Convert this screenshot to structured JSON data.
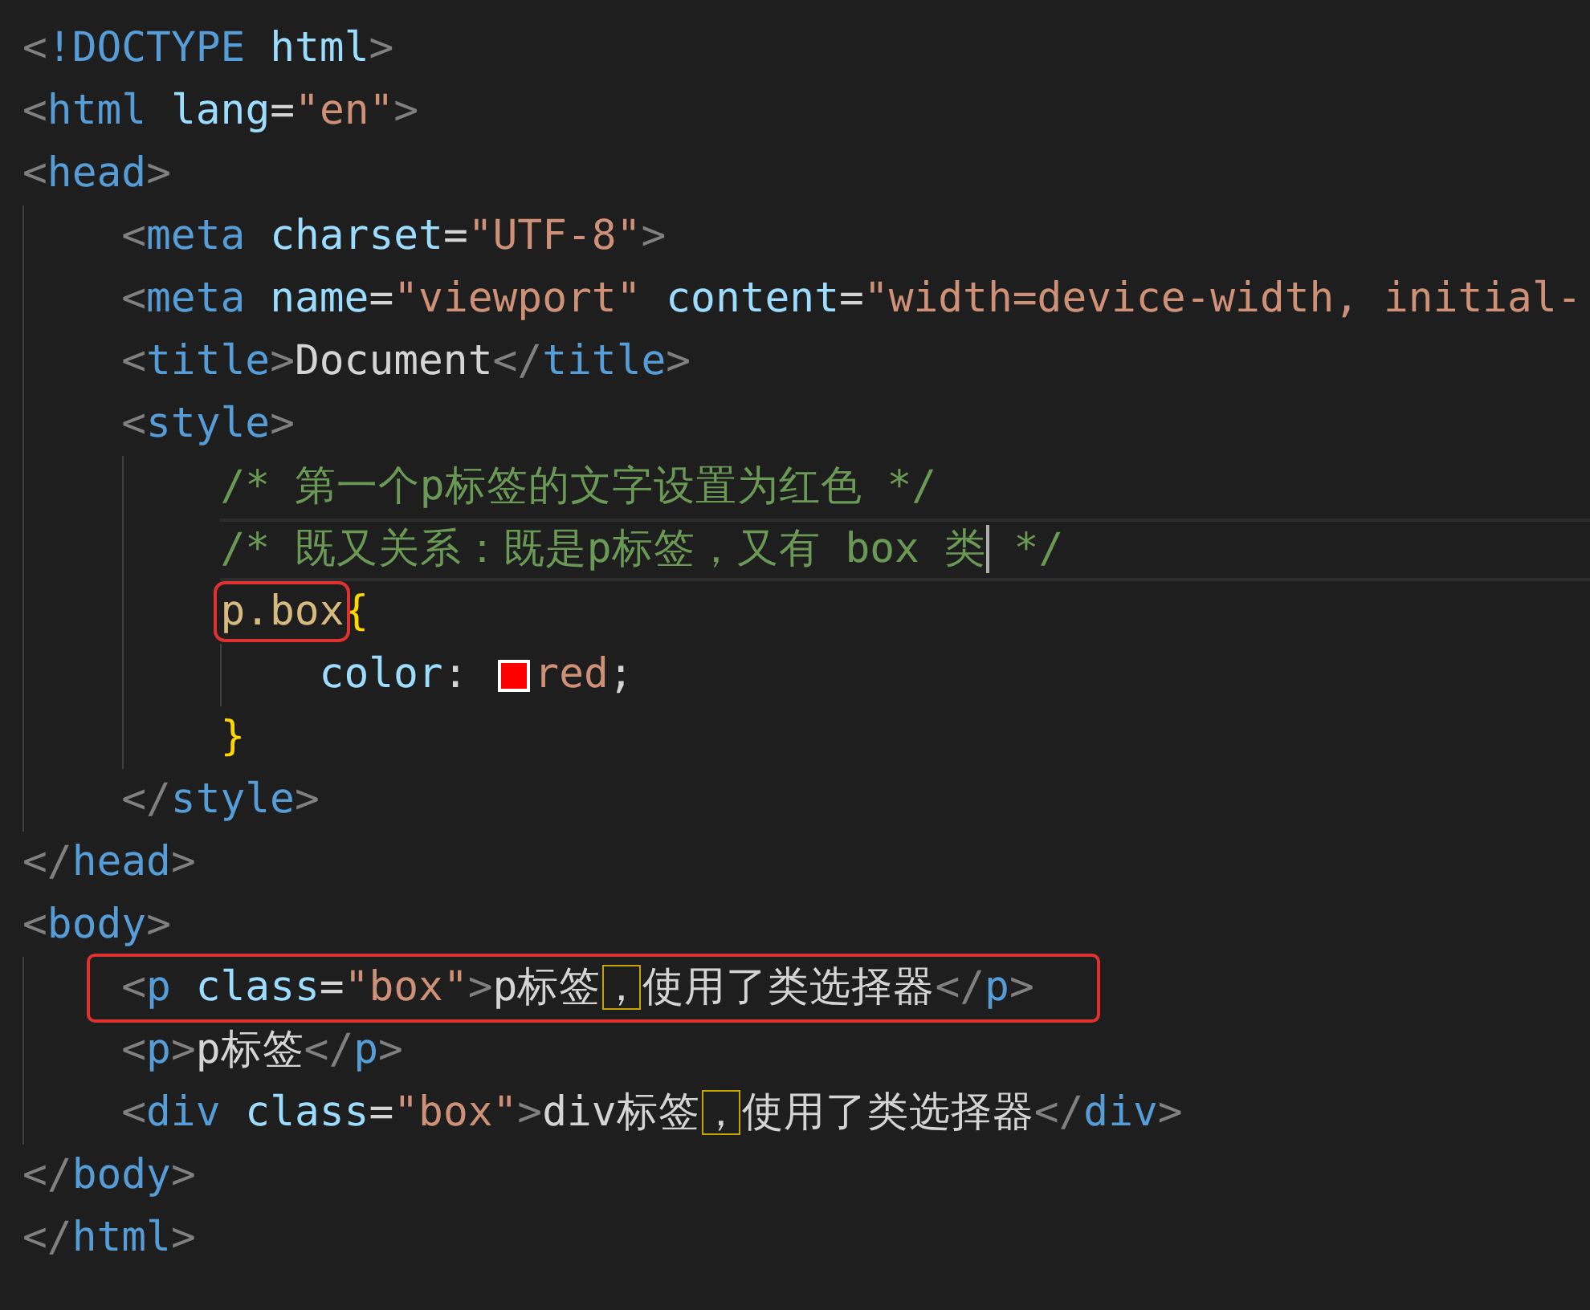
{
  "lines": [
    {
      "tokens": [
        {
          "kind": "punct",
          "text": "<"
        },
        {
          "kind": "tag",
          "text": "!DOCTYPE "
        },
        {
          "kind": "attr",
          "text": "html"
        },
        {
          "kind": "punct",
          "text": ">"
        }
      ]
    },
    {
      "tokens": [
        {
          "kind": "punct",
          "text": "<"
        },
        {
          "kind": "tag",
          "text": "html "
        },
        {
          "kind": "attr",
          "text": "lang"
        },
        {
          "kind": "text",
          "text": "="
        },
        {
          "kind": "string",
          "text": "\"en\""
        },
        {
          "kind": "punct",
          "text": ">"
        }
      ]
    },
    {
      "tokens": [
        {
          "kind": "punct",
          "text": "<"
        },
        {
          "kind": "tag",
          "text": "head"
        },
        {
          "kind": "punct",
          "text": ">"
        }
      ],
      "children": [
        {
          "tokens": [
            {
              "kind": "punct",
              "text": "<"
            },
            {
              "kind": "tag",
              "text": "meta "
            },
            {
              "kind": "attr",
              "text": "charset"
            },
            {
              "kind": "text",
              "text": "="
            },
            {
              "kind": "string",
              "text": "\"UTF-8\""
            },
            {
              "kind": "punct",
              "text": ">"
            }
          ]
        },
        {
          "tokens": [
            {
              "kind": "punct",
              "text": "<"
            },
            {
              "kind": "tag",
              "text": "meta "
            },
            {
              "kind": "attr",
              "text": "name"
            },
            {
              "kind": "text",
              "text": "="
            },
            {
              "kind": "string",
              "text": "\"viewport\" "
            },
            {
              "kind": "attr",
              "text": "content"
            },
            {
              "kind": "text",
              "text": "="
            },
            {
              "kind": "string",
              "text": "\"width=device-width, initial-"
            }
          ]
        },
        {
          "tokens": [
            {
              "kind": "punct",
              "text": "<"
            },
            {
              "kind": "tag",
              "text": "title"
            },
            {
              "kind": "punct",
              "text": ">"
            },
            {
              "kind": "text",
              "text": "Document"
            },
            {
              "kind": "punct",
              "text": "</"
            },
            {
              "kind": "tag",
              "text": "title"
            },
            {
              "kind": "punct",
              "text": ">"
            }
          ]
        },
        {
          "tokens": [
            {
              "kind": "punct",
              "text": "<"
            },
            {
              "kind": "tag",
              "text": "style"
            },
            {
              "kind": "punct",
              "text": ">"
            }
          ],
          "children": [
            {
              "tokens": [
                {
                  "kind": "comment",
                  "text": "/* 第一个p标签的文字设置为红色 */"
                }
              ]
            },
            {
              "current": true,
              "tokens": [
                {
                  "kind": "comment",
                  "text": "/* 既又关系：既是p标签，又有 box 类",
                  "caret_after": true
                },
                {
                  "kind": "comment",
                  "text": " */"
                }
              ]
            },
            {
              "tokens": [
                {
                  "kind": "selector",
                  "text": "p.box",
                  "outlined": true
                },
                {
                  "kind": "brace",
                  "text": "{"
                }
              ],
              "children": [
                {
                  "tokens": [
                    {
                      "kind": "prop",
                      "text": "color"
                    },
                    {
                      "kind": "text",
                      "text": ": "
                    },
                    {
                      "kind": "swatch",
                      "color": "#ff0000"
                    },
                    {
                      "kind": "value",
                      "text": "red"
                    },
                    {
                      "kind": "text",
                      "text": ";"
                    }
                  ]
                }
              ]
            },
            {
              "tokens": [
                {
                  "kind": "brace",
                  "text": "}"
                }
              ]
            }
          ]
        },
        {
          "tokens": [
            {
              "kind": "punct",
              "text": "</"
            },
            {
              "kind": "tag",
              "text": "style"
            },
            {
              "kind": "punct",
              "text": ">"
            }
          ]
        }
      ]
    },
    {
      "tokens": [
        {
          "kind": "punct",
          "text": "</"
        },
        {
          "kind": "tag",
          "text": "head"
        },
        {
          "kind": "punct",
          "text": ">"
        }
      ]
    },
    {
      "tokens": [
        {
          "kind": "punct",
          "text": "<"
        },
        {
          "kind": "tag",
          "text": "body"
        },
        {
          "kind": "punct",
          "text": ">"
        }
      ],
      "children": [
        {
          "outlined": true,
          "tokens": [
            {
              "kind": "punct",
              "text": "<"
            },
            {
              "kind": "tag",
              "text": "p "
            },
            {
              "kind": "attr",
              "text": "class"
            },
            {
              "kind": "text",
              "text": "="
            },
            {
              "kind": "string",
              "text": "\"box\""
            },
            {
              "kind": "punct",
              "text": ">"
            },
            {
              "kind": "text",
              "text": "p标签"
            },
            {
              "kind": "unusual",
              "text": "，"
            },
            {
              "kind": "text",
              "text": "使用了类选择器"
            },
            {
              "kind": "punct",
              "text": "</"
            },
            {
              "kind": "tag",
              "text": "p"
            },
            {
              "kind": "punct",
              "text": ">"
            }
          ]
        },
        {
          "tokens": [
            {
              "kind": "punct",
              "text": "<"
            },
            {
              "kind": "tag",
              "text": "p"
            },
            {
              "kind": "punct",
              "text": ">"
            },
            {
              "kind": "text",
              "text": "p标签"
            },
            {
              "kind": "punct",
              "text": "</"
            },
            {
              "kind": "tag",
              "text": "p"
            },
            {
              "kind": "punct",
              "text": ">"
            }
          ]
        },
        {
          "tokens": [
            {
              "kind": "punct",
              "text": "<"
            },
            {
              "kind": "tag",
              "text": "div "
            },
            {
              "kind": "attr",
              "text": "class"
            },
            {
              "kind": "text",
              "text": "="
            },
            {
              "kind": "string",
              "text": "\"box\""
            },
            {
              "kind": "punct",
              "text": ">"
            },
            {
              "kind": "text",
              "text": "div标签"
            },
            {
              "kind": "unusual",
              "text": "，"
            },
            {
              "kind": "text",
              "text": "使用了类选择器"
            },
            {
              "kind": "punct",
              "text": "</"
            },
            {
              "kind": "tag",
              "text": "div"
            },
            {
              "kind": "punct",
              "text": ">"
            }
          ]
        }
      ]
    },
    {
      "tokens": [
        {
          "kind": "punct",
          "text": "</"
        },
        {
          "kind": "tag",
          "text": "body"
        },
        {
          "kind": "punct",
          "text": ">"
        }
      ]
    },
    {
      "tokens": [
        {
          "kind": "punct",
          "text": "</"
        },
        {
          "kind": "tag",
          "text": "html"
        },
        {
          "kind": "punct",
          "text": ">"
        }
      ]
    }
  ]
}
